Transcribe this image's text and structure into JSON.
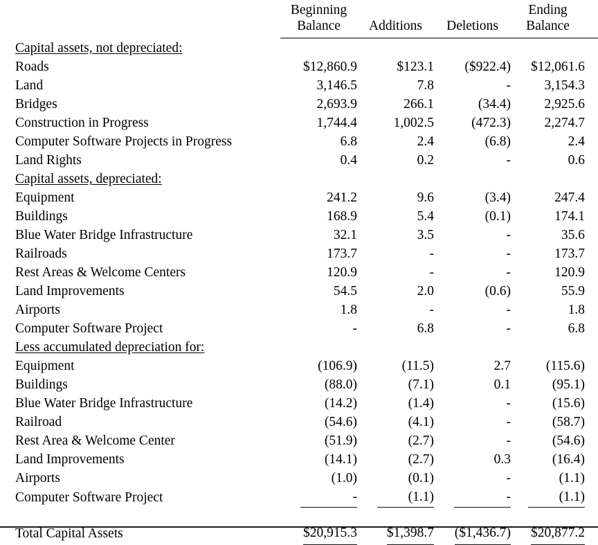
{
  "table": {
    "columns": [
      {
        "line1": "Beginning",
        "line2": "Balance"
      },
      {
        "line1": "Additions",
        "line2": ""
      },
      {
        "line1": "Deletions",
        "line2": ""
      },
      {
        "line1": "Ending",
        "line2": "Balance"
      }
    ],
    "rows": [
      {
        "type": "section",
        "label": "Capital assets, not depreciated:",
        "values": [
          "",
          "",
          "",
          ""
        ]
      },
      {
        "type": "data",
        "label": "Roads",
        "values": [
          "$12,860.9",
          "$123.1",
          "($922.4)",
          "$12,061.6"
        ]
      },
      {
        "type": "data",
        "label": "Land",
        "values": [
          "3,146.5",
          "7.8",
          "-",
          "3,154.3"
        ]
      },
      {
        "type": "data",
        "label": "Bridges",
        "values": [
          "2,693.9",
          "266.1",
          "(34.4)",
          "2,925.6"
        ]
      },
      {
        "type": "data",
        "label": "Construction in Progress",
        "values": [
          "1,744.4",
          "1,002.5",
          "(472.3)",
          "2,274.7"
        ]
      },
      {
        "type": "data",
        "label": "Computer Software Projects in Progress",
        "values": [
          "6.8",
          "2.4",
          "(6.8)",
          "2.4"
        ]
      },
      {
        "type": "data",
        "label": "Land Rights",
        "values": [
          "0.4",
          "0.2",
          "-",
          "0.6"
        ]
      },
      {
        "type": "section",
        "label": "Capital assets, depreciated:",
        "values": [
          "",
          "",
          "",
          ""
        ]
      },
      {
        "type": "data",
        "label": "Equipment",
        "values": [
          "241.2",
          "9.6",
          "(3.4)",
          "247.4"
        ]
      },
      {
        "type": "data",
        "label": "Buildings",
        "values": [
          "168.9",
          "5.4",
          "(0.1)",
          "174.1"
        ]
      },
      {
        "type": "data",
        "label": "Blue Water Bridge Infrastructure",
        "values": [
          "32.1",
          "3.5",
          "-",
          "35.6"
        ]
      },
      {
        "type": "data",
        "label": "Railroads",
        "values": [
          "173.7",
          "-",
          "-",
          "173.7"
        ]
      },
      {
        "type": "data",
        "label": "Rest Areas & Welcome Centers",
        "values": [
          "120.9",
          "-",
          "-",
          "120.9"
        ]
      },
      {
        "type": "data",
        "label": "Land Improvements",
        "values": [
          "54.5",
          "2.0",
          "(0.6)",
          "55.9"
        ]
      },
      {
        "type": "data",
        "label": "Airports",
        "values": [
          "1.8",
          "-",
          "-",
          "1.8"
        ]
      },
      {
        "type": "data",
        "label": "Computer Software Project",
        "values": [
          "-",
          "6.8",
          "-",
          "6.8"
        ]
      },
      {
        "type": "section",
        "label": "Less accumulated depreciation for:",
        "values": [
          "",
          "",
          "",
          ""
        ]
      },
      {
        "type": "data",
        "label": "Equipment",
        "values": [
          "(106.9)",
          "(11.5)",
          "2.7",
          "(115.6)"
        ]
      },
      {
        "type": "data",
        "label": "Buildings",
        "values": [
          "(88.0)",
          "(7.1)",
          "0.1",
          "(95.1)"
        ]
      },
      {
        "type": "data",
        "label": "Blue Water Bridge Infrastructure",
        "values": [
          "(14.2)",
          "(1.4)",
          "-",
          "(15.6)"
        ]
      },
      {
        "type": "data",
        "label": "Railroad",
        "values": [
          "(54.6)",
          "(4.1)",
          "-",
          "(58.7)"
        ]
      },
      {
        "type": "data",
        "label": "Rest Area & Welcome Center",
        "values": [
          "(51.9)",
          "(2.7)",
          "-",
          "(54.6)"
        ]
      },
      {
        "type": "data",
        "label": "Land Improvements",
        "values": [
          "(14.1)",
          "(2.7)",
          "0.3",
          "(16.4)"
        ]
      },
      {
        "type": "data",
        "label": "Airports",
        "values": [
          "(1.0)",
          "(0.1)",
          "-",
          "(1.1)"
        ]
      },
      {
        "type": "subtotal",
        "label": "Computer Software Project",
        "values": [
          "-",
          "(1.1)",
          "-",
          "(1.1)"
        ]
      },
      {
        "type": "spacer",
        "label": "",
        "values": [
          "",
          "",
          "",
          ""
        ]
      },
      {
        "type": "total",
        "label": "Total Capital Assets",
        "values": [
          "$20,915.3",
          "$1,398.7",
          "($1,436.7)",
          "$20,877.2"
        ]
      }
    ]
  },
  "style": {
    "rule_color": "#7a7a7a",
    "text_color": "#000000",
    "bottom_border_color": "#1a1a1a"
  }
}
